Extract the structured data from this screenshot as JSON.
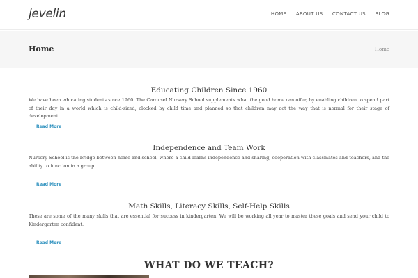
{
  "header": {
    "logo": "jevelin",
    "nav": [
      "HOME",
      "ABOUT US",
      "CONTACT US",
      "BLOG"
    ]
  },
  "title_bar": {
    "title": "Home",
    "breadcrumb": "Home"
  },
  "sections": [
    {
      "heading": "Educating Children Since 1960",
      "body": "We have been educating students since 1960. The Carousel Nursery School supplements what the good home can offer, by enabling children to spend part of their day in a world which is child-sized, clocked by child time and planned so that children may act the way that is normal for their stage of development.",
      "link": "Read More"
    },
    {
      "heading": "Independence and Team Work",
      "body": "Nursery School is the bridge between home and school, where a child learns independence and sharing, cooperation with classmates and teachers, and the ability to function in a group.",
      "link": "Read More"
    },
    {
      "heading": "Math Skills, Literacy Skills, Self-Help Skills",
      "body": "These are some of the many skills that are essential for success in kindergarten. We will be working all year to master these goals and send your child to Kindergarten confident.",
      "link": "Read More"
    }
  ],
  "teach_heading": "WHAT DO WE TEACH?",
  "colors": {
    "accent": "#2a8fbd",
    "title_bar_bg": "#f6f6f6",
    "text": "#333333"
  }
}
